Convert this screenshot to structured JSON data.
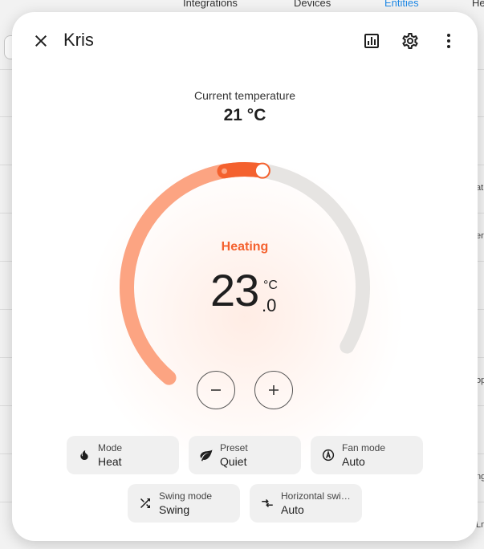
{
  "background": {
    "tabs": [
      "Integrations",
      "Devices",
      "Entities",
      "He"
    ],
    "active_tab": "Entities",
    "fragments": [
      "at",
      "era",
      "op",
      "ng",
      "Ln"
    ]
  },
  "dialog": {
    "title": "Kris",
    "current_temperature": {
      "label": "Current temperature",
      "value": "21 °C"
    },
    "thermostat": {
      "state": "Heating",
      "target_integer": "23",
      "target_decimal": ".0",
      "unit": "°C",
      "current_value": 21,
      "target_value": 23,
      "min": 7,
      "max": 35
    },
    "controls": {
      "decrease": "−",
      "increase": "+"
    },
    "features": [
      {
        "label": "Mode",
        "value": "Heat",
        "icon": "fire-icon"
      },
      {
        "label": "Preset",
        "value": "Quiet",
        "icon": "leaf-icon"
      },
      {
        "label": "Fan mode",
        "value": "Auto",
        "icon": "fan-auto-icon"
      },
      {
        "label": "Swing mode",
        "value": "Swing",
        "icon": "shuffle-icon"
      },
      {
        "label": "Horizontal swi…",
        "value": "Auto",
        "icon": "horizontal-swing-icon"
      }
    ],
    "colors": {
      "heat_accent": "#f4612e",
      "heat_light": "#fca482",
      "track": "#e6e4e2"
    }
  }
}
